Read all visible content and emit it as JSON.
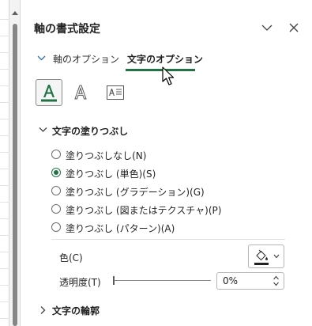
{
  "pane": {
    "title": "軸の書式設定"
  },
  "tabs": [
    {
      "label": "軸のオプション",
      "active": false
    },
    {
      "label": "文字のオプション",
      "active": true
    }
  ],
  "icon_tabs": [
    {
      "icon": "text-fill-icon",
      "active": true
    },
    {
      "icon": "text-outline-icon",
      "active": false
    },
    {
      "icon": "textbox-icon",
      "active": false
    }
  ],
  "fill_section": {
    "title": "文字の塗りつぶし",
    "expanded": true,
    "options": [
      {
        "label": "塗りつぶしなし(N)",
        "selected": false
      },
      {
        "label": "塗りつぶし (単色)(S)",
        "selected": true
      },
      {
        "label": "塗りつぶし (グラデーション)(G)",
        "selected": false
      },
      {
        "label": "塗りつぶし (図またはテクスチャ)(P)",
        "selected": false
      },
      {
        "label": "塗りつぶし (パターン)(A)",
        "selected": false
      }
    ],
    "color_label": "色(C)",
    "color_value": "#000000",
    "transparency_label": "透明度(T)",
    "transparency_value": "0%"
  },
  "outline_section": {
    "title": "文字の輪郭",
    "expanded": false
  },
  "colors": {
    "accent": "#217346"
  }
}
